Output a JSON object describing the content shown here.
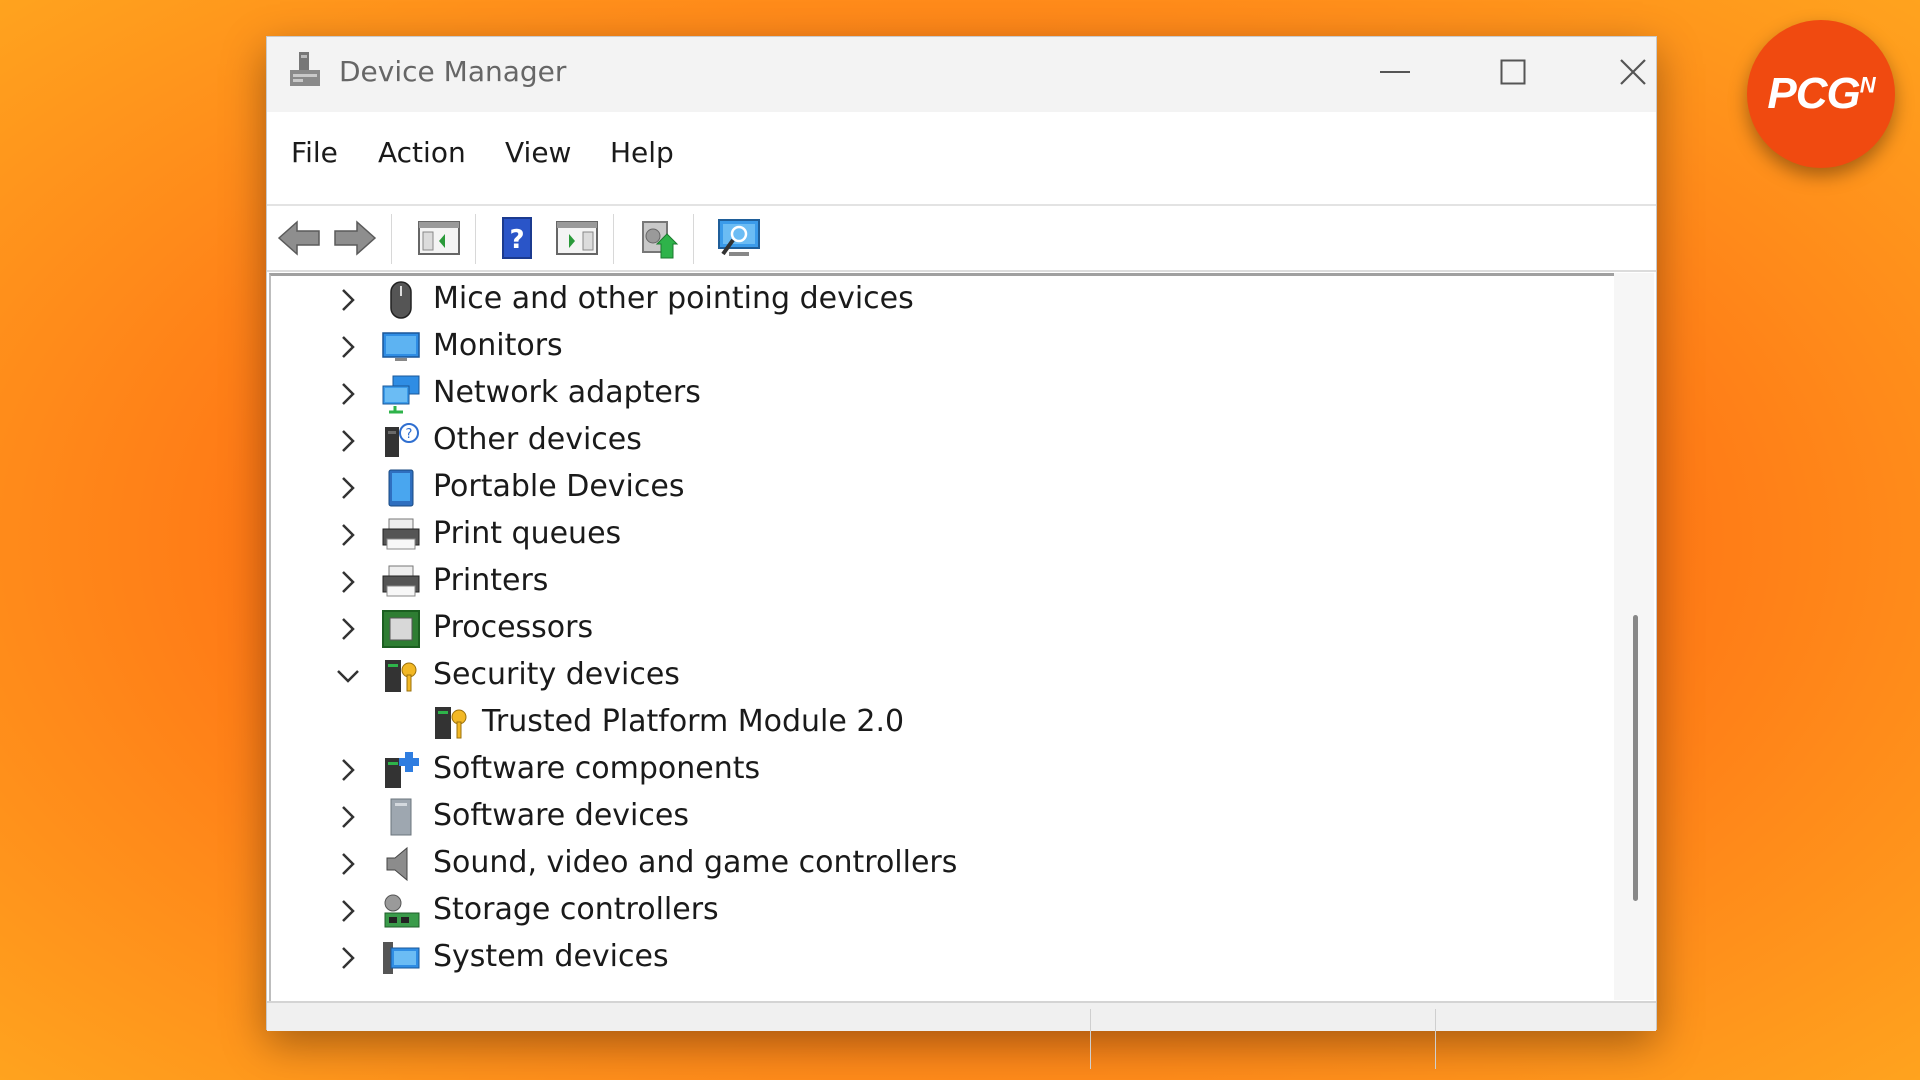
{
  "window": {
    "title": "Device Manager"
  },
  "menu": [
    {
      "label": "File"
    },
    {
      "label": "Action"
    },
    {
      "label": "View"
    },
    {
      "label": "Help"
    }
  ],
  "toolbar": {
    "buttons": [
      {
        "icon": "back-arrow-icon"
      },
      {
        "icon": "forward-arrow-icon"
      },
      {
        "icon": "show-hide-console-tree-icon"
      },
      {
        "icon": "help-icon"
      },
      {
        "icon": "show-action-pane-icon"
      },
      {
        "icon": "update-driver-icon"
      },
      {
        "icon": "scan-hardware-changes-icon"
      }
    ]
  },
  "tree": [
    {
      "label": "Mice and other pointing devices",
      "icon": "mouse-icon",
      "expanded": false
    },
    {
      "label": "Monitors",
      "icon": "monitor-icon",
      "expanded": false
    },
    {
      "label": "Network adapters",
      "icon": "network-adapter-icon",
      "expanded": false
    },
    {
      "label": "Other devices",
      "icon": "unknown-device-icon",
      "expanded": false
    },
    {
      "label": "Portable Devices",
      "icon": "portable-device-icon",
      "expanded": false
    },
    {
      "label": "Print queues",
      "icon": "printer-icon",
      "expanded": false
    },
    {
      "label": "Printers",
      "icon": "printer-icon",
      "expanded": false
    },
    {
      "label": "Processors",
      "icon": "processor-icon",
      "expanded": false
    },
    {
      "label": "Security devices",
      "icon": "security-device-icon",
      "expanded": true
    },
    {
      "label": "Trusted Platform Module 2.0",
      "icon": "security-device-icon",
      "child": true
    },
    {
      "label": "Software components",
      "icon": "software-component-icon",
      "expanded": false
    },
    {
      "label": "Software devices",
      "icon": "software-device-icon",
      "expanded": false
    },
    {
      "label": "Sound, video and game controllers",
      "icon": "speaker-icon",
      "expanded": false
    },
    {
      "label": "Storage controllers",
      "icon": "storage-controller-icon",
      "expanded": false
    },
    {
      "label": "System devices",
      "icon": "system-device-icon",
      "expanded": false
    }
  ],
  "logo": {
    "text": "PCG",
    "sup": "N",
    "color": "#f04a10"
  }
}
